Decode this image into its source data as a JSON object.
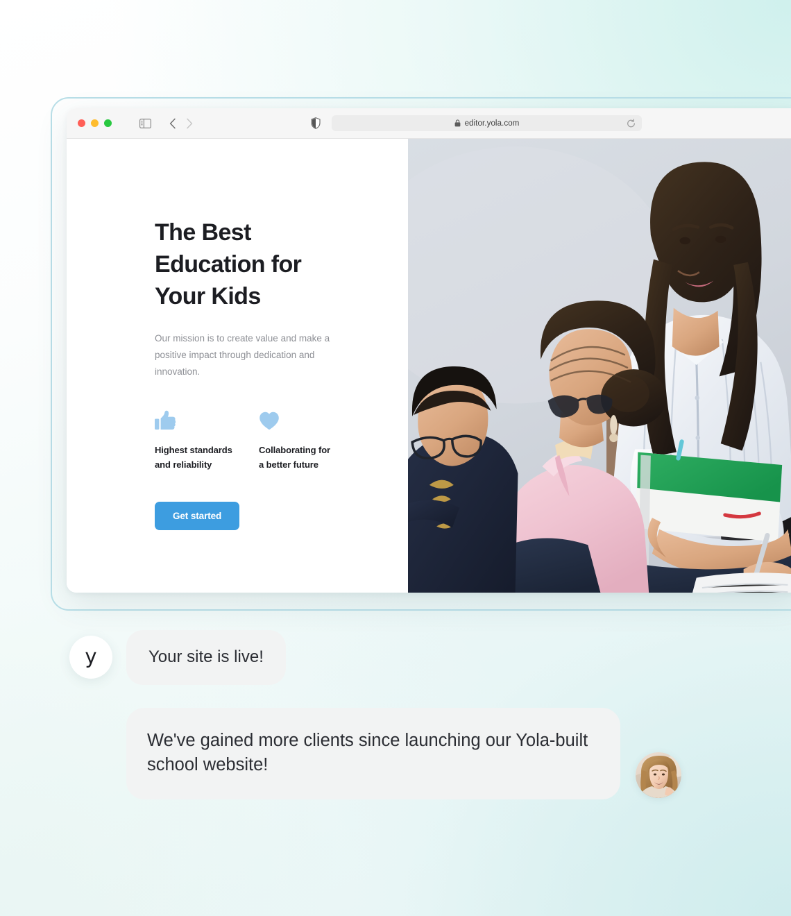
{
  "browser": {
    "traffic_lights": [
      {
        "name": "close",
        "color": "#ff5f57"
      },
      {
        "name": "minimize",
        "color": "#febc2e"
      },
      {
        "name": "maximize",
        "color": "#28c840"
      }
    ],
    "sidebar_toggle_icon": "sidebar-icon",
    "back_icon": "chevron-left-icon",
    "forward_icon": "chevron-right-icon",
    "shield_icon": "shield-icon",
    "lock_icon": "lock-icon",
    "reload_icon": "reload-icon",
    "url": "editor.yola.com"
  },
  "hero": {
    "headline": "The Best\nEducation for\nYour Kids",
    "subcopy": "Our mission is to create value and make a positive impact through dedication and innovation.",
    "features": [
      {
        "icon": "thumbs-up-icon",
        "label": "Highest standards\nand reliability"
      },
      {
        "icon": "heart-icon",
        "label": "Collaborating for\na better future"
      }
    ],
    "cta_label": "Get started",
    "photo_alt": "classroom-students-photo"
  },
  "chat": {
    "brand_avatar_letter": "y",
    "messages": [
      {
        "from": "brand",
        "text": "Your site is live!"
      },
      {
        "from": "user",
        "text": "We've gained more clients since launching our Yola-built school website!"
      }
    ],
    "user_avatar_alt": "smiling-woman-photo"
  },
  "colors": {
    "accent_blue": "#3d9de0",
    "icon_blue": "#9ecbee",
    "bubble_gray": "#f2f3f3",
    "frame_border": "#b9dfe8",
    "text_dark": "#1c1d22",
    "text_muted": "#8d8f95"
  }
}
